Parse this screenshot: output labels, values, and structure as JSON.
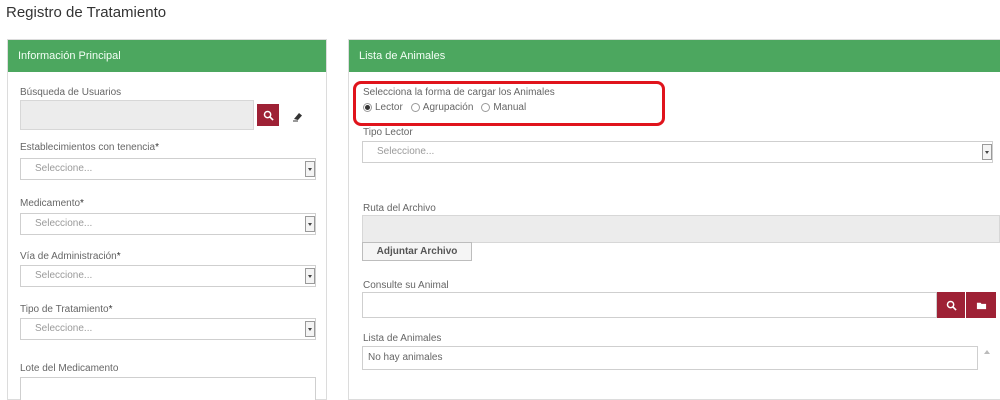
{
  "page_title": "Registro de Tratamiento",
  "left_panel": {
    "header": "Información Principal",
    "busqueda_label": "Búsqueda de Usuarios",
    "establecimientos_label": "Establecimientos con tenencia",
    "establecimientos_value": "Seleccione...",
    "medicamento_label": "Medicamento",
    "medicamento_value": "Seleccione...",
    "via_label": "Vía de Administración",
    "via_value": "Seleccione...",
    "tipo_label": "Tipo de Tratamiento",
    "tipo_value": "Seleccione...",
    "lote_label": "Lote del Medicamento",
    "required_mark": "*"
  },
  "right_panel": {
    "header": "Lista de Animales",
    "load_prompt": "Selecciona la forma de cargar los Animales",
    "radio_options": [
      "Lector",
      "Agrupación",
      "Manual"
    ],
    "radio_selected": "Lector",
    "tipo_lector_label": "Tipo Lector",
    "tipo_lector_value": "Seleccione...",
    "ruta_label": "Ruta del Archivo",
    "attach_button": "Adjuntar Archivo",
    "consulte_label": "Consulte su Animal",
    "lista_label": "Lista de Animales",
    "lista_empty": "No hay animales"
  },
  "colors": {
    "header_green": "#4ca75f",
    "button_maroon": "#9e2135",
    "highlight_red": "#e0141c"
  },
  "icons": [
    "search-icon",
    "eraser-icon",
    "folder-icon"
  ]
}
